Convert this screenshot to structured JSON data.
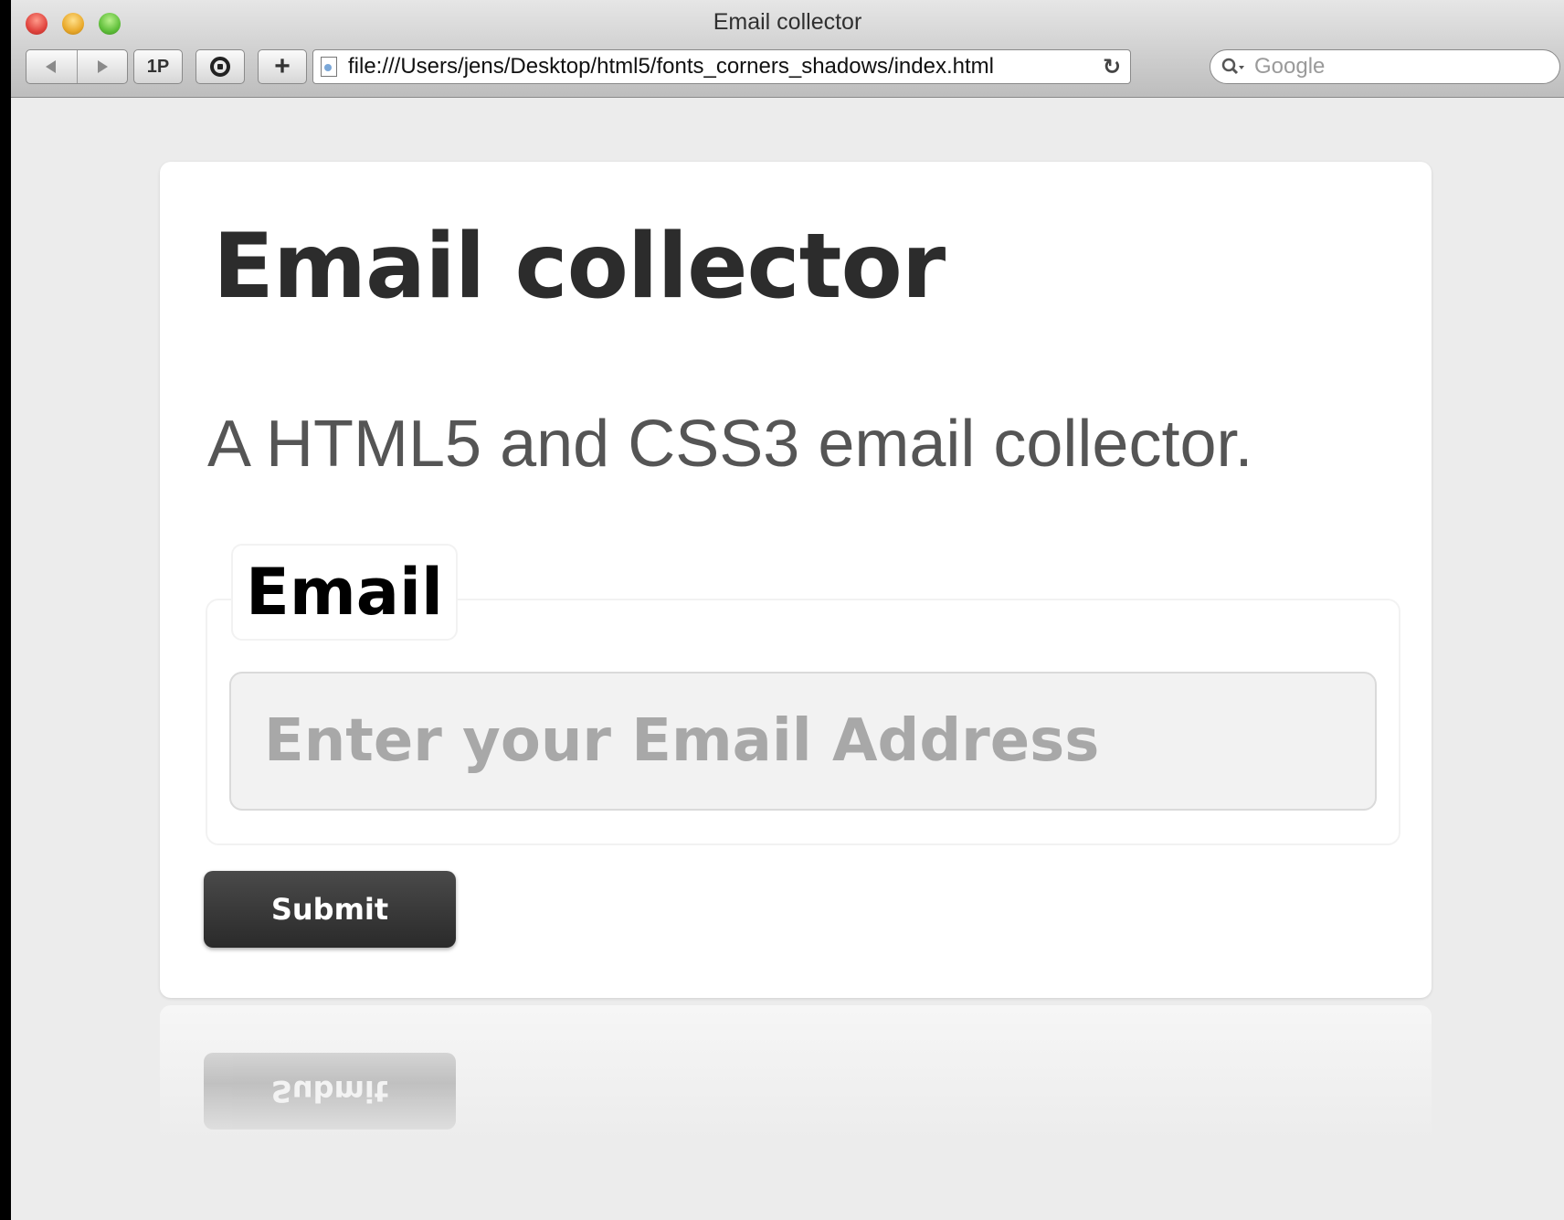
{
  "window": {
    "title": "Email collector"
  },
  "toolbar": {
    "back_icon": "back-arrow-icon",
    "forward_icon": "forward-arrow-icon",
    "onepassword_label": "1P",
    "plus_label": "+",
    "url": "file:///Users/jens/Desktop/html5/fonts_corners_shadows/index.html",
    "reload_glyph": "↻",
    "search_placeholder": "Google"
  },
  "page": {
    "heading": "Email collector",
    "subtitle": "A HTML5 and CSS3 email collector.",
    "form": {
      "legend": "Email",
      "email_placeholder": "Enter your Email Address",
      "submit_label": "Submit"
    }
  },
  "colors": {
    "button_dark": "#2f2f2f",
    "page_background": "#ececec",
    "heading_text": "#2c2c2c"
  }
}
